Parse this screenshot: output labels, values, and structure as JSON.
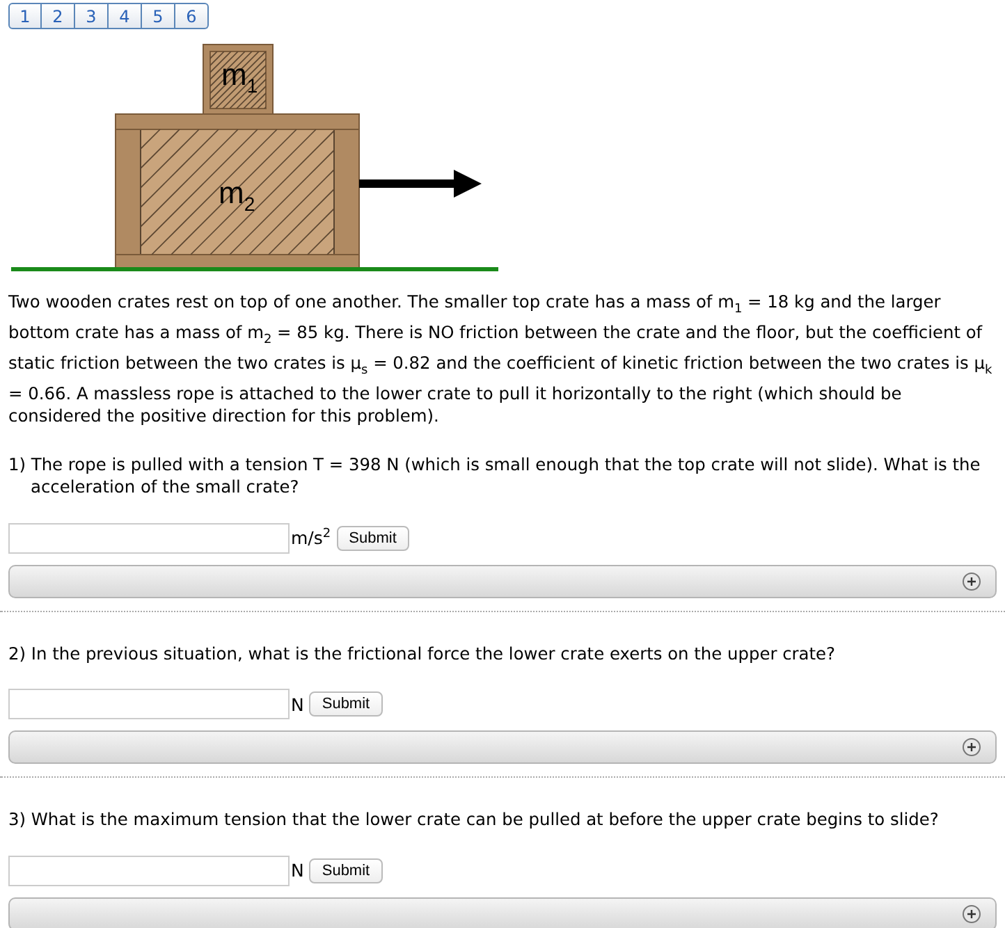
{
  "page_tabs": [
    {
      "label": "1"
    },
    {
      "label": "2"
    },
    {
      "label": "3"
    },
    {
      "label": "4"
    },
    {
      "label": "5"
    },
    {
      "label": "6"
    }
  ],
  "diagram": {
    "top_crate_label": "m$_{1}$",
    "bottom_crate_label": "m$_{2}$"
  },
  "problem_text": "Two wooden crates rest on top of one another. The smaller top crate has a mass of m$_{1}$ = 18 kg and the larger bottom crate has a mass of m$_{2}$ = 85 kg. There is NO friction between the crate and the floor, but the coefficient of static friction between the two crates is μ$_{s}$ = 0.82 and the coefficient of kinetic friction between the two crates is μ$_{k}$ = 0.66. A massless rope is attached to the lower crate to pull it horizontally to the right (which should be considered the positive direction for this problem).",
  "questions": [
    {
      "text": "1) The rope is pulled with a tension T = 398 N (which is small enough that the top crate will not slide). What is the acceleration of the small crate?",
      "unit": "m/s$^{2}$",
      "button": "Submit"
    },
    {
      "text": "2) In the previous situation, what is the frictional force the lower crate exerts on the upper crate?",
      "unit": "N",
      "button": "Submit"
    },
    {
      "text": "3) What is the maximum tension that the lower crate can be pulled at before the upper crate begins to slide?",
      "unit": "N",
      "button": "Submit"
    }
  ]
}
